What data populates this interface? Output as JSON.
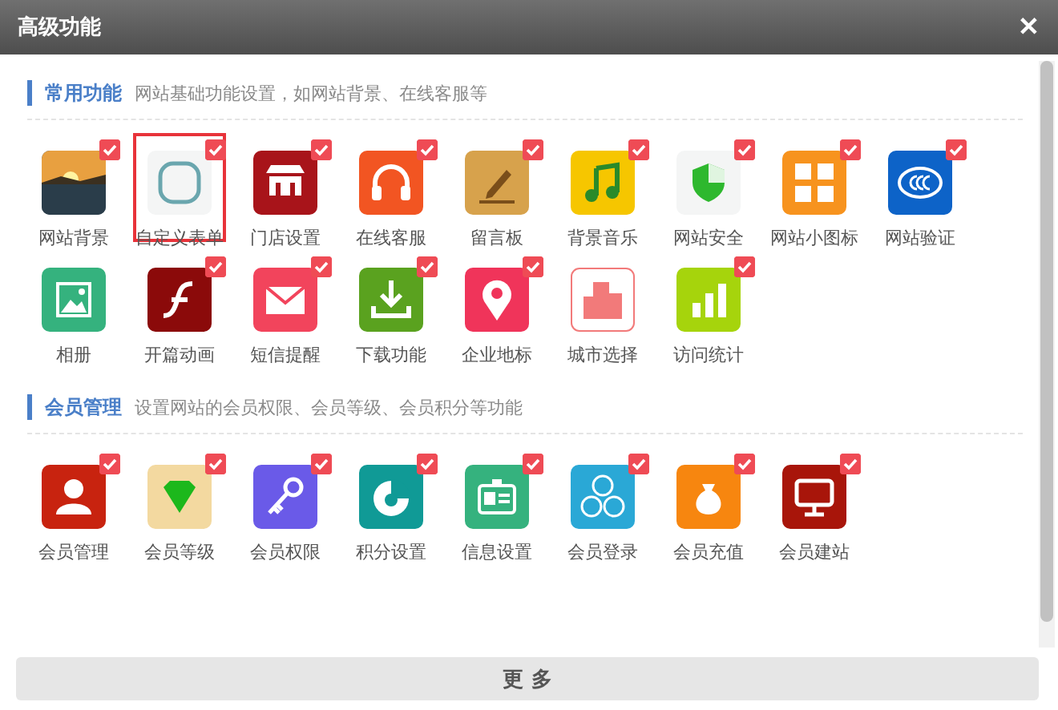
{
  "dialog": {
    "title": "高级功能",
    "close": "✕"
  },
  "sections": [
    {
      "title": "常用功能",
      "description": "网站基础功能设置，如网站背景、在线客服等",
      "items": [
        {
          "label": "网站背景",
          "checked": true,
          "selected": false
        },
        {
          "label": "自定义表单",
          "checked": true,
          "selected": true
        },
        {
          "label": "门店设置",
          "checked": true,
          "selected": false
        },
        {
          "label": "在线客服",
          "checked": true,
          "selected": false
        },
        {
          "label": "留言板",
          "checked": true,
          "selected": false
        },
        {
          "label": "背景音乐",
          "checked": true,
          "selected": false
        },
        {
          "label": "网站安全",
          "checked": true,
          "selected": false
        },
        {
          "label": "网站小图标",
          "checked": true,
          "selected": false
        },
        {
          "label": "网站验证",
          "checked": true,
          "selected": false
        },
        {
          "label": "相册",
          "checked": false,
          "selected": false
        },
        {
          "label": "开篇动画",
          "checked": true,
          "selected": false
        },
        {
          "label": "短信提醒",
          "checked": true,
          "selected": false
        },
        {
          "label": "下载功能",
          "checked": true,
          "selected": false
        },
        {
          "label": "企业地标",
          "checked": true,
          "selected": false
        },
        {
          "label": "城市选择",
          "checked": false,
          "selected": false
        },
        {
          "label": "访问统计",
          "checked": true,
          "selected": false
        }
      ]
    },
    {
      "title": "会员管理",
      "description": "设置网站的会员权限、会员等级、会员积分等功能",
      "items": [
        {
          "label": "会员管理",
          "checked": true,
          "selected": false
        },
        {
          "label": "会员等级",
          "checked": true,
          "selected": false
        },
        {
          "label": "会员权限",
          "checked": true,
          "selected": false
        },
        {
          "label": "积分设置",
          "checked": true,
          "selected": false
        },
        {
          "label": "信息设置",
          "checked": true,
          "selected": false
        },
        {
          "label": "会员登录",
          "checked": true,
          "selected": false
        },
        {
          "label": "会员充值",
          "checked": true,
          "selected": false
        },
        {
          "label": "会员建站",
          "checked": true,
          "selected": false
        }
      ]
    }
  ],
  "footer": {
    "button": "更 多"
  }
}
